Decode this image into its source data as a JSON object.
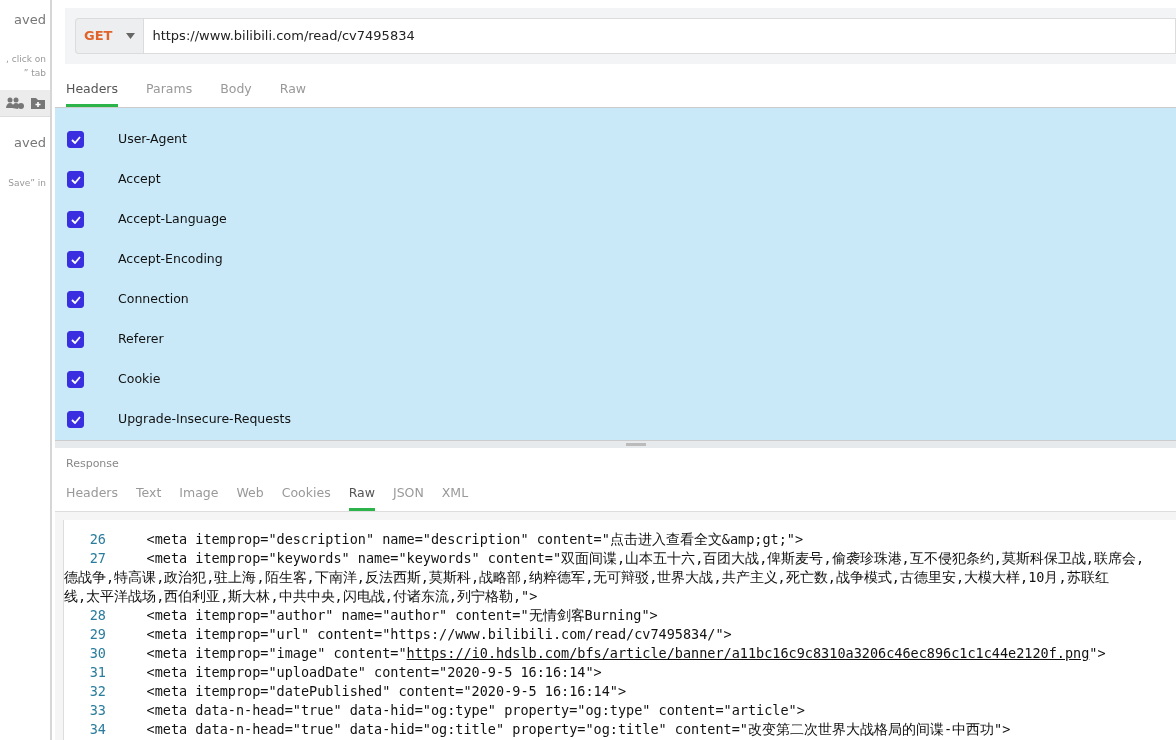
{
  "sidebar": {
    "texts": [
      {
        "kind": "heading",
        "text": "aved"
      },
      {
        "kind": "note",
        "text": ", click on"
      },
      {
        "kind": "note",
        "text": "” tab"
      },
      {
        "kind": "toolbar"
      },
      {
        "kind": "heading",
        "text": "aved"
      },
      {
        "kind": "note",
        "text": "Save” in"
      }
    ]
  },
  "request": {
    "method": "GET",
    "url": "https://www.bilibili.com/read/cv7495834",
    "tabs": [
      {
        "label": "Headers",
        "selected": true
      },
      {
        "label": "Params",
        "selected": false
      },
      {
        "label": "Body",
        "selected": false
      },
      {
        "label": "Raw",
        "selected": false
      }
    ],
    "headers": [
      {
        "name": "User-Agent",
        "checked": true
      },
      {
        "name": "Accept",
        "checked": true
      },
      {
        "name": "Accept-Language",
        "checked": true
      },
      {
        "name": "Accept-Encoding",
        "checked": true
      },
      {
        "name": "Connection",
        "checked": true
      },
      {
        "name": "Referer",
        "checked": true
      },
      {
        "name": "Cookie",
        "checked": true
      },
      {
        "name": "Upgrade-Insecure-Requests",
        "checked": true
      }
    ]
  },
  "response": {
    "label": "Response",
    "tabs": [
      {
        "label": "Headers",
        "selected": false
      },
      {
        "label": "Text",
        "selected": false
      },
      {
        "label": "Image",
        "selected": false
      },
      {
        "label": "Web",
        "selected": false
      },
      {
        "label": "Cookies",
        "selected": false
      },
      {
        "label": "Raw",
        "selected": true
      },
      {
        "label": "JSON",
        "selected": false
      },
      {
        "label": "XML",
        "selected": false
      }
    ],
    "lines": [
      {
        "number": "26",
        "rows": [
          "    <meta itemprop=\"description\" name=\"description\" content=\"点击进入查看全文&amp;gt;\">"
        ]
      },
      {
        "number": "27",
        "rows": [
          "    <meta itemprop=\"keywords\" name=\"keywords\" content=\"双面间谍,山本五十六,百团大战,俾斯麦号,偷袭珍珠港,互不侵犯条约,莫斯科保卫战,联席会,",
          "德战争,特高课,政治犯,驻上海,陌生客,下南洋,反法西斯,莫斯科,战略部,纳粹德军,无可辩驳,世界大战,共产主义,死亡数,战争模式,古德里安,大模大样,10月,苏联红",
          "线,太平洋战场,西伯利亚,斯大林,中共中央,闪电战,付诸东流,列宁格勒,\">"
        ]
      },
      {
        "number": "28",
        "rows": [
          "    <meta itemprop=\"author\" name=\"author\" content=\"无情剑客Burning\">"
        ]
      },
      {
        "number": "29",
        "rows": [
          "    <meta itemprop=\"url\" content=\"https://www.bilibili.com/read/cv7495834/\">"
        ]
      },
      {
        "number": "30",
        "rows": [
          "    <meta itemprop=\"image\" content=\"",
          "https://i0.hdslb.com/bfs/article/banner/a11bc16c9c8310a3206c46ec896c1c1c44e2120f.png",
          "\">"
        ],
        "kind": "link"
      },
      {
        "number": "31",
        "rows": [
          "    <meta itemprop=\"uploadDate\" content=\"2020-9-5 16:16:14\">"
        ]
      },
      {
        "number": "32",
        "rows": [
          "    <meta itemprop=\"datePublished\" content=\"2020-9-5 16:16:14\">"
        ]
      },
      {
        "number": "33",
        "rows": [
          "    <meta data-n-head=\"true\" data-hid=\"og:type\" property=\"og:type\" content=\"article\">"
        ]
      },
      {
        "number": "34",
        "rows": [
          "    <meta data-n-head=\"true\" data-hid=\"og:title\" property=\"og:title\" content=\"改变第二次世界大战格局的间谍-中西功\">"
        ]
      }
    ]
  }
}
